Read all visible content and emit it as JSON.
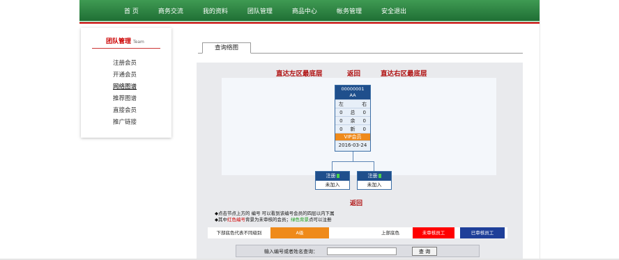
{
  "nav": {
    "items": [
      "首 页",
      "商务交流",
      "我的资料",
      "团队管理",
      "商品中心",
      "帐务管理",
      "安全退出"
    ]
  },
  "sidebar": {
    "title": "团队管理",
    "title_en": "Team",
    "items": [
      "注册会员",
      "开通会员",
      "网络图谱",
      "推荐图谱",
      "直接会员",
      "推广链接"
    ]
  },
  "tab": {
    "label": "查询络图"
  },
  "tree": {
    "jump_left": "直达左区最底层",
    "back": "返回",
    "jump_right": "直达右区最底层",
    "root": {
      "id": "00000001",
      "name": "AA",
      "left_label": "左",
      "right_label": "右",
      "rows": [
        {
          "left": "0",
          "label": "总",
          "right": "0"
        },
        {
          "left": "0",
          "label": "余",
          "right": "0"
        },
        {
          "left": "0",
          "label": "新",
          "right": "0"
        }
      ],
      "level": "VIP会员",
      "date": "2016-03-24"
    },
    "children": [
      {
        "title": "注册",
        "status": "未加入"
      },
      {
        "title": "注册",
        "status": "未加入"
      }
    ],
    "back_bottom": "返回"
  },
  "notes": {
    "line1": "◆点击节点上方的 编号 可以看到该编号会员的四层以内下属",
    "line2_a": "◆其中",
    "line2_red": "红色编号",
    "line2_b": "背景为未审核的会员；",
    "line2_green": "绿色背景",
    "line2_c": "点可以注册"
  },
  "legend": {
    "bottom_label": "下部底色代表不同级别",
    "level_label": "A级",
    "top_label": "上部底色",
    "unreviewed": "未审核员工",
    "reviewed": "已审核员工"
  },
  "search": {
    "label": "输入编号或者姓名查询：",
    "value": "",
    "button": "查 询"
  },
  "colors": {
    "nav_green": "#2e8a45",
    "accent_red": "#cc0000",
    "node_blue": "#1f4f8c",
    "vip_orange": "#ef8a1a",
    "legend_red": "#ff0000",
    "legend_blue": "#1e3f99"
  }
}
